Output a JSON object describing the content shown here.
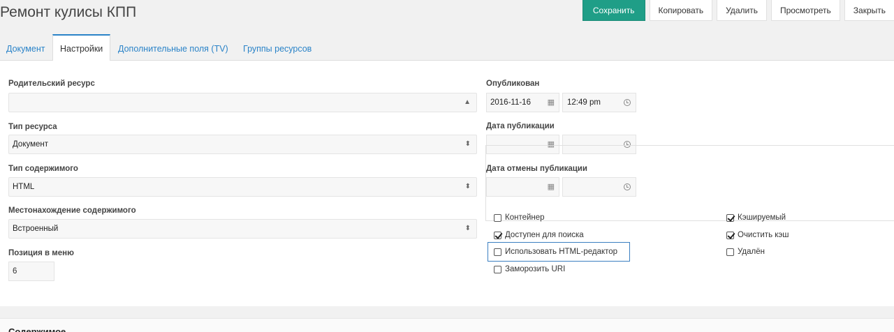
{
  "page": {
    "title": "Ремонт кулисы КПП"
  },
  "actions": {
    "save": "Сохранить",
    "copy": "Копировать",
    "delete": "Удалить",
    "view": "Просмотреть",
    "close": "Закрыть"
  },
  "tabs": [
    "Документ",
    "Настройки",
    "Дополнительные поля (TV)",
    "Группы ресурсов"
  ],
  "form": {
    "parent_label": "Родительский ресурс",
    "parent_value": "",
    "type_label": "Тип ресурса",
    "type_value": "Документ",
    "content_type_label": "Тип содержимого",
    "content_type_value": "HTML",
    "disposition_label": "Местонахождение содержимого",
    "disposition_value": "Встроенный",
    "menu_index_label": "Позиция в меню",
    "menu_index_value": "6",
    "published_label": "Опубликован",
    "published_date": "2016-11-16",
    "published_time": "12:49 pm",
    "pub_date_label": "Дата публикации",
    "unpub_date_label": "Дата отмены публикации"
  },
  "checkboxes": {
    "container": {
      "label": "Контейнер",
      "checked": false
    },
    "searchable": {
      "label": "Доступен для поиска",
      "checked": true
    },
    "richtext": {
      "label": "Использовать HTML-редактор",
      "checked": false
    },
    "freeze_uri": {
      "label": "Заморозить URI",
      "checked": false
    },
    "cacheable": {
      "label": "Кэшируемый",
      "checked": true
    },
    "clear_cache": {
      "label": "Очистить кэш",
      "checked": true
    },
    "deleted": {
      "label": "Удалён",
      "checked": false
    }
  },
  "section": {
    "title": "Содержимое"
  },
  "colors": {
    "primary": "#1f9e87",
    "link": "#2a83c8",
    "focus": "#3a7fc1"
  },
  "icons": [
    "calendar-icon",
    "clock-icon",
    "select-arrows-icon",
    "checkbox-icon"
  ]
}
